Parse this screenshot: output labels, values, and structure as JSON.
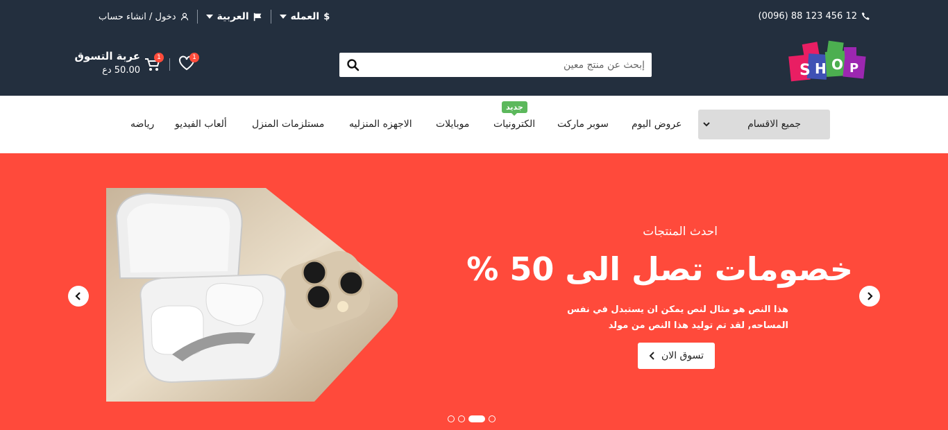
{
  "topbar": {
    "phone": "(0096) 88 123 456 12",
    "currency": "العمله",
    "language": "العربية",
    "account": "دخول / انشاء حساب"
  },
  "header": {
    "logo_text": "SHOP",
    "search_placeholder": "إبحث عن منتج معين",
    "cart_title": "عربة التسوق",
    "cart_total": "50.00 دع",
    "cart_count": "1",
    "wishlist_count": "1"
  },
  "nav": {
    "all_categories": "جميع الاقسام",
    "items": [
      "عروض اليوم",
      "سوبر ماركت",
      "الكترونيات",
      "موبايلات",
      "الاجهزه المنزليه",
      "مستلزمات المنزل",
      "ألعاب الفيديو",
      "رياضه"
    ],
    "new_badge": "جديد"
  },
  "hero": {
    "eyebrow": "احدث المنتجات",
    "headline": "خصومات تصل الى 50 %",
    "description": "هذا النص هو مثال لنص يمكن ان يستبدل في نفس المساحه, لقد تم توليد هذا النص من مولد",
    "cta": "تسوق الان",
    "slide_count": 4,
    "active_slide": 3
  },
  "colors": {
    "header_bg": "#232f3e",
    "hero_bg": "#ff4a3b",
    "badge": "#ff4c3b",
    "new_tag": "#5cb85c"
  }
}
